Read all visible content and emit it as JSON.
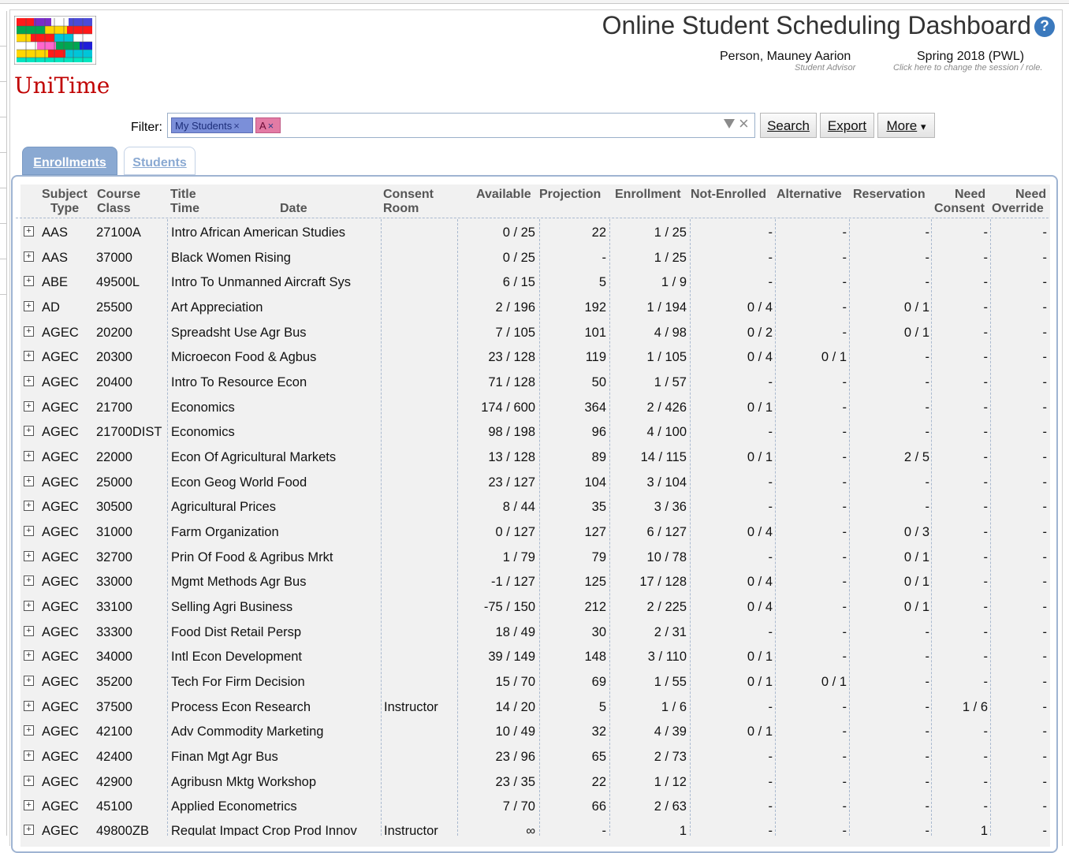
{
  "app": {
    "title": "Online Student Scheduling Dashboard",
    "logo_text": "UniTime",
    "help_icon": "?"
  },
  "user": {
    "name": "Person, Mauney Aarion",
    "role": "Student Advisor"
  },
  "session": {
    "name": "Spring 2018 (PWL)",
    "hint": "Click here to change the session / role."
  },
  "filter": {
    "label": "Filter:",
    "chips": [
      {
        "label": "My Students",
        "remove": "×"
      },
      {
        "label": "A",
        "remove": "×"
      }
    ],
    "clear_icon": "×"
  },
  "buttons": {
    "search": "Search",
    "export": "Export",
    "more": "More",
    "more_arrow": "▾"
  },
  "tabs": [
    {
      "label": "Enrollments",
      "active": true
    },
    {
      "label": "Students",
      "active": false
    }
  ],
  "headers": {
    "subject_1": "Subject",
    "subject_2": "Type",
    "course_1": "Course",
    "course_2": "Class",
    "title_1": "Title",
    "title_2": "Time",
    "date": "Date",
    "consent_1": "Consent",
    "consent_2": "Room",
    "available": "Available",
    "projection": "Projection",
    "enrollment": "Enrollment",
    "not_enrolled": "Not-Enrolled",
    "alternative": "Alternative",
    "reservation": "Reservation",
    "need_consent_1": "Need",
    "need_consent_2": "Consent",
    "need_override_1": "Need",
    "need_override_2": "Override"
  },
  "rows": [
    {
      "subject": "AAS",
      "course": "27100A",
      "title": "Intro African American Studies",
      "consent": "",
      "available": "0 / 25",
      "projection": "22",
      "enrollment": "1 / 25",
      "not_enrolled": "-",
      "alternative": "-",
      "reservation": "-",
      "need_consent": "-",
      "need_override": "-"
    },
    {
      "subject": "AAS",
      "course": "37000",
      "title": "Black Women Rising",
      "consent": "",
      "available": "0 / 25",
      "projection": "-",
      "enrollment": "1 / 25",
      "not_enrolled": "-",
      "alternative": "-",
      "reservation": "-",
      "need_consent": "-",
      "need_override": "-"
    },
    {
      "subject": "ABE",
      "course": "49500L",
      "title": "Intro To Unmanned Aircraft Sys",
      "consent": "",
      "available": "6 / 15",
      "projection": "5",
      "enrollment": "1 / 9",
      "not_enrolled": "-",
      "alternative": "-",
      "reservation": "-",
      "need_consent": "-",
      "need_override": "-"
    },
    {
      "subject": "AD",
      "course": "25500",
      "title": "Art Appreciation",
      "consent": "",
      "available": "2 / 196",
      "projection": "192",
      "enrollment": "1 / 194",
      "not_enrolled": "0 / 4",
      "alternative": "-",
      "reservation": "0 / 1",
      "need_consent": "-",
      "need_override": "-"
    },
    {
      "subject": "AGEC",
      "course": "20200",
      "title": "Spreadsht Use Agr Bus",
      "consent": "",
      "available": "7 / 105",
      "projection": "101",
      "enrollment": "4 / 98",
      "not_enrolled": "0 / 2",
      "alternative": "-",
      "reservation": "0 / 1",
      "need_consent": "-",
      "need_override": "-"
    },
    {
      "subject": "AGEC",
      "course": "20300",
      "title": "Microecon Food & Agbus",
      "consent": "",
      "available": "23 / 128",
      "projection": "119",
      "enrollment": "1 / 105",
      "not_enrolled": "0 / 4",
      "alternative": "0 / 1",
      "reservation": "-",
      "need_consent": "-",
      "need_override": "-"
    },
    {
      "subject": "AGEC",
      "course": "20400",
      "title": "Intro To Resource Econ",
      "consent": "",
      "available": "71 / 128",
      "projection": "50",
      "enrollment": "1 / 57",
      "not_enrolled": "-",
      "alternative": "-",
      "reservation": "-",
      "need_consent": "-",
      "need_override": "-"
    },
    {
      "subject": "AGEC",
      "course": "21700",
      "title": "Economics",
      "consent": "",
      "available": "174 / 600",
      "projection": "364",
      "enrollment": "2 / 426",
      "not_enrolled": "0 / 1",
      "alternative": "-",
      "reservation": "-",
      "need_consent": "-",
      "need_override": "-"
    },
    {
      "subject": "AGEC",
      "course": "21700DIST",
      "title": "Economics",
      "consent": "",
      "available": "98 / 198",
      "projection": "96",
      "enrollment": "4 / 100",
      "not_enrolled": "-",
      "alternative": "-",
      "reservation": "-",
      "need_consent": "-",
      "need_override": "-"
    },
    {
      "subject": "AGEC",
      "course": "22000",
      "title": "Econ Of Agricultural Markets",
      "consent": "",
      "available": "13 / 128",
      "projection": "89",
      "enrollment": "14 / 115",
      "not_enrolled": "0 / 1",
      "alternative": "-",
      "reservation": "2 / 5",
      "need_consent": "-",
      "need_override": "-"
    },
    {
      "subject": "AGEC",
      "course": "25000",
      "title": "Econ Geog World Food",
      "consent": "",
      "available": "23 / 127",
      "projection": "104",
      "enrollment": "3 / 104",
      "not_enrolled": "-",
      "alternative": "-",
      "reservation": "-",
      "need_consent": "-",
      "need_override": "-"
    },
    {
      "subject": "AGEC",
      "course": "30500",
      "title": "Agricultural Prices",
      "consent": "",
      "available": "8 / 44",
      "projection": "35",
      "enrollment": "3 / 36",
      "not_enrolled": "-",
      "alternative": "-",
      "reservation": "-",
      "need_consent": "-",
      "need_override": "-"
    },
    {
      "subject": "AGEC",
      "course": "31000",
      "title": "Farm Organization",
      "consent": "",
      "available": "0 / 127",
      "projection": "127",
      "enrollment": "6 / 127",
      "not_enrolled": "0 / 4",
      "alternative": "-",
      "reservation": "0 / 3",
      "need_consent": "-",
      "need_override": "-"
    },
    {
      "subject": "AGEC",
      "course": "32700",
      "title": "Prin Of Food & Agribus Mrkt",
      "consent": "",
      "available": "1 / 79",
      "projection": "79",
      "enrollment": "10 / 78",
      "not_enrolled": "-",
      "alternative": "-",
      "reservation": "0 / 1",
      "need_consent": "-",
      "need_override": "-"
    },
    {
      "subject": "AGEC",
      "course": "33000",
      "title": "Mgmt Methods Agr Bus",
      "consent": "",
      "available": "-1 / 127",
      "projection": "125",
      "enrollment": "17 / 128",
      "not_enrolled": "0 / 4",
      "alternative": "-",
      "reservation": "0 / 1",
      "need_consent": "-",
      "need_override": "-"
    },
    {
      "subject": "AGEC",
      "course": "33100",
      "title": "Selling Agri Business",
      "consent": "",
      "available": "-75 / 150",
      "projection": "212",
      "enrollment": "2 / 225",
      "not_enrolled": "0 / 4",
      "alternative": "-",
      "reservation": "0 / 1",
      "need_consent": "-",
      "need_override": "-"
    },
    {
      "subject": "AGEC",
      "course": "33300",
      "title": "Food Dist Retail Persp",
      "consent": "",
      "available": "18 / 49",
      "projection": "30",
      "enrollment": "2 / 31",
      "not_enrolled": "-",
      "alternative": "-",
      "reservation": "-",
      "need_consent": "-",
      "need_override": "-"
    },
    {
      "subject": "AGEC",
      "course": "34000",
      "title": "Intl Econ Development",
      "consent": "",
      "available": "39 / 149",
      "projection": "148",
      "enrollment": "3 / 110",
      "not_enrolled": "0 / 1",
      "alternative": "-",
      "reservation": "-",
      "need_consent": "-",
      "need_override": "-"
    },
    {
      "subject": "AGEC",
      "course": "35200",
      "title": "Tech For Firm Decision",
      "consent": "",
      "available": "15 / 70",
      "projection": "69",
      "enrollment": "1 / 55",
      "not_enrolled": "0 / 1",
      "alternative": "0 / 1",
      "reservation": "-",
      "need_consent": "-",
      "need_override": "-"
    },
    {
      "subject": "AGEC",
      "course": "37500",
      "title": "Process Econ Research",
      "consent": "Instructor",
      "available": "14 / 20",
      "projection": "5",
      "enrollment": "1 / 6",
      "not_enrolled": "-",
      "alternative": "-",
      "reservation": "-",
      "need_consent": "1 / 6",
      "need_override": "-"
    },
    {
      "subject": "AGEC",
      "course": "42100",
      "title": "Adv Commodity Marketing",
      "consent": "",
      "available": "10 / 49",
      "projection": "32",
      "enrollment": "4 / 39",
      "not_enrolled": "0 / 1",
      "alternative": "-",
      "reservation": "-",
      "need_consent": "-",
      "need_override": "-"
    },
    {
      "subject": "AGEC",
      "course": "42400",
      "title": "Finan Mgt Agr Bus",
      "consent": "",
      "available": "23 / 96",
      "projection": "65",
      "enrollment": "2 / 73",
      "not_enrolled": "-",
      "alternative": "-",
      "reservation": "-",
      "need_consent": "-",
      "need_override": "-"
    },
    {
      "subject": "AGEC",
      "course": "42900",
      "title": "Agribusn Mktg Workshop",
      "consent": "",
      "available": "23 / 35",
      "projection": "22",
      "enrollment": "1 / 12",
      "not_enrolled": "-",
      "alternative": "-",
      "reservation": "-",
      "need_consent": "-",
      "need_override": "-"
    },
    {
      "subject": "AGEC",
      "course": "45100",
      "title": "Applied Econometrics",
      "consent": "",
      "available": "7 / 70",
      "projection": "66",
      "enrollment": "2 / 63",
      "not_enrolled": "-",
      "alternative": "-",
      "reservation": "-",
      "need_consent": "-",
      "need_override": "-"
    },
    {
      "subject": "AGEC",
      "course": "49800ZB",
      "title": "Regulat Impact Crop Prod Innov",
      "consent": "Instructor",
      "available": "∞",
      "projection": "-",
      "enrollment": "1",
      "not_enrolled": "-",
      "alternative": "-",
      "reservation": "-",
      "need_consent": "1",
      "need_override": "-"
    }
  ]
}
